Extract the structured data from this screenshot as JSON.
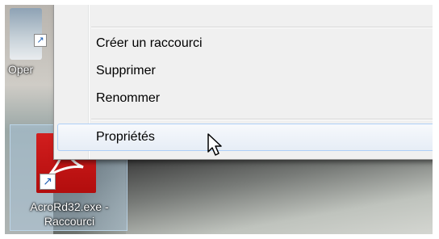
{
  "desktop": {
    "top_icon_label": "Oper",
    "selected_icon_label_line1": "AcroRd32.exe -",
    "selected_icon_label_line2": "Raccourci"
  },
  "context_menu": {
    "items": [
      {
        "label": "Créer un raccourci"
      },
      {
        "label": "Supprimer"
      },
      {
        "label": "Renommer"
      },
      {
        "label": "Propriétés"
      }
    ],
    "highlighted_item": "Propriétés"
  },
  "colors": {
    "menu_background": "#f0f0f0",
    "highlight_border": "#aecff7",
    "pdf_icon_red": "#c41414"
  },
  "icons": [
    "shortcut-arrow-icon",
    "pdf-icon",
    "mouse-pointer-icon"
  ]
}
